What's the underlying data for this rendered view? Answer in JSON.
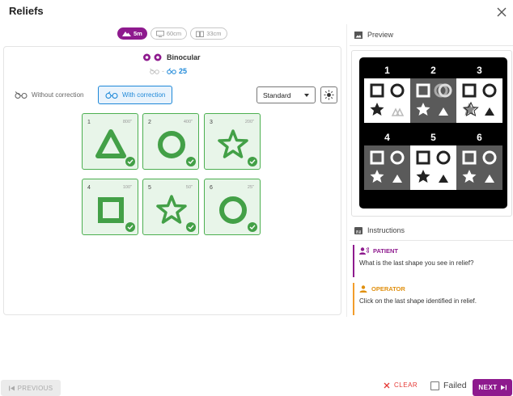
{
  "window": {
    "title": "Reliefs",
    "close_icon": "close-icon"
  },
  "distance_pills": [
    {
      "label": "5m",
      "icon": "mountain-icon",
      "active": true
    },
    {
      "label": "60cm",
      "icon": "monitor-icon",
      "active": false
    },
    {
      "label": "33cm",
      "icon": "book-icon",
      "active": false
    }
  ],
  "vision_mode": {
    "label": "Binocular",
    "icon": "eyes-icon"
  },
  "acuity": {
    "without_value": "-",
    "with_value": "25"
  },
  "correction": {
    "without_label": "Without correction",
    "with_label": "With correction",
    "selected": "with"
  },
  "display_select": {
    "value": "Standard"
  },
  "brightness_icon": "sun-icon",
  "tiles": [
    {
      "number": "1",
      "angle": "800\"",
      "shape": "triangle",
      "checked": true
    },
    {
      "number": "2",
      "angle": "400\"",
      "shape": "circle",
      "checked": true
    },
    {
      "number": "3",
      "angle": "200\"",
      "shape": "star",
      "checked": true
    },
    {
      "number": "4",
      "angle": "100\"",
      "shape": "square",
      "checked": true
    },
    {
      "number": "5",
      "angle": "50\"",
      "shape": "star",
      "checked": true
    },
    {
      "number": "6",
      "angle": "25\"",
      "shape": "circle",
      "checked": true
    }
  ],
  "preview": {
    "heading": "Preview",
    "cells": [
      "1",
      "2",
      "3",
      "4",
      "5",
      "6"
    ]
  },
  "instructions": {
    "heading": "Instructions",
    "patient_label": "PATIENT",
    "patient_text": "What is the last shape you see in relief?",
    "operator_label": "OPERATOR",
    "operator_text": "Click on the last shape identified in relief."
  },
  "footer": {
    "previous_label": "PREVIOUS",
    "clear_label": "CLEAR",
    "failed_label": "Failed",
    "next_label": "NEXT"
  },
  "colors": {
    "accent": "#8e1a8e",
    "tile_green": "#43a047",
    "link_blue": "#1e88d8",
    "operator_orange": "#f29d2b",
    "clear_red": "#e53935"
  }
}
